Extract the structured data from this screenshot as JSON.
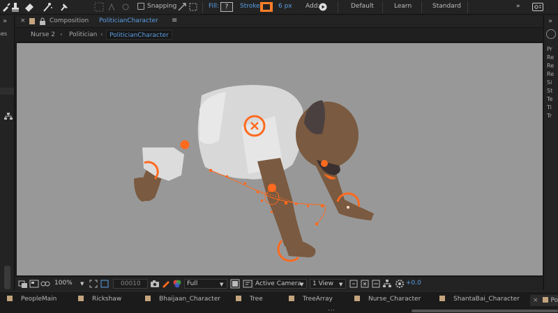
{
  "toolbar": {
    "snapping_label": "Snapping",
    "fill_label": "Fill:",
    "fill_value": "?",
    "stroke_label": "Stroke:",
    "stroke_width": "6 px",
    "add_label": "Add:",
    "workspaces": [
      "Default",
      "Learn",
      "Standard"
    ],
    "stroke_color": "#ff7e29"
  },
  "composition": {
    "label": "Composition",
    "name": "PoliticianCharacter",
    "breadcrumbs": [
      "Nurse 2",
      "Politician",
      "PoliticianCharacter"
    ]
  },
  "viewer_bar": {
    "zoom": "100%",
    "timecode": "00010",
    "resolution": "Full",
    "camera": "Active Camera",
    "views": "1 View",
    "exposure": "+0.0"
  },
  "right_panel": {
    "items": [
      "Pr",
      "Re",
      "Re",
      "Re",
      "Si",
      "St",
      "Te",
      "Ti",
      "Tr"
    ]
  },
  "left_panel": {
    "label": "nes"
  },
  "tabs": [
    {
      "label": "PeopleMain"
    },
    {
      "label": "Rickshaw"
    },
    {
      "label": "Bhaijaan_Character"
    },
    {
      "label": "Tree"
    },
    {
      "label": "TreeArray"
    },
    {
      "label": "Nurse_Character"
    },
    {
      "label": "ShantaBai_Character"
    },
    {
      "label": "Poli"
    }
  ],
  "colors": {
    "accent_blue": "#5b9fe5",
    "handle_orange": "#ff6a1f",
    "skin": "#7a5a40",
    "shirt": "#dcdcdc",
    "canvas": "#989898"
  }
}
